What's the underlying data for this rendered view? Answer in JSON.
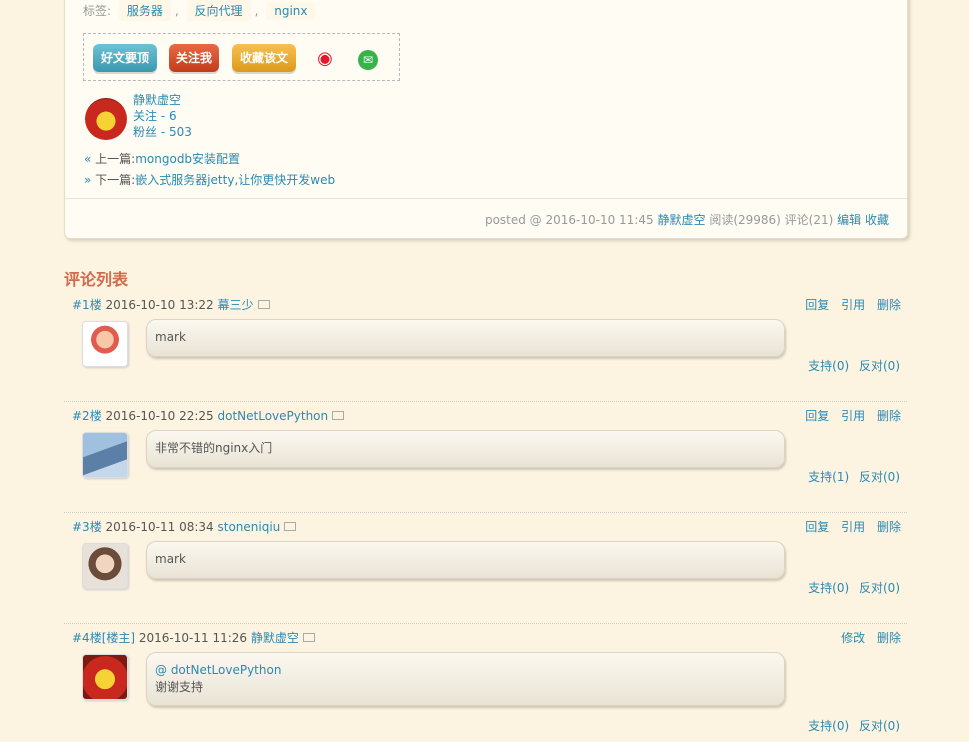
{
  "post": {
    "tags_label": "标签:",
    "tags": [
      "服务器",
      "反向代理",
      "nginx"
    ],
    "tag_sep": ",",
    "buttons": {
      "good": "好文要顶",
      "follow": "关注我",
      "favorite": "收藏该文"
    },
    "share_icons": [
      "weibo-icon",
      "wechat-icon"
    ],
    "author": {
      "name": "静默虚空",
      "following": "关注 - 6",
      "fans": "粉丝 - 503"
    },
    "nav": {
      "prev_arrow": "«",
      "prev_prefix": "上一篇:",
      "prev_title": "mongodb安装配置",
      "next_arrow": "»",
      "next_prefix": "下一篇:",
      "next_title": "嵌入式服务器jetty,让你更快开发web"
    },
    "footer": {
      "posted": "posted @ 2016-10-10 11:45",
      "author": "静默虚空",
      "stats": "阅读(29986) 评论(21)",
      "edit": "编辑",
      "favorite": "收藏"
    }
  },
  "comments_title": "评论列表",
  "comments": [
    {
      "floor": "#1楼",
      "time": "2016-10-10 13:22",
      "user": "幕三少",
      "actions": [
        "回复",
        "引用",
        "删除"
      ],
      "lines": [
        "mark"
      ],
      "support": "支持(0)",
      "oppose": "反对(0)"
    },
    {
      "floor": "#2楼",
      "time": "2016-10-10 22:25",
      "user": "dotNetLovePython",
      "actions": [
        "回复",
        "引用",
        "删除"
      ],
      "lines": [
        "非常不错的nginx入门"
      ],
      "support": "支持(1)",
      "oppose": "反对(0)"
    },
    {
      "floor": "#3楼",
      "time": "2016-10-11 08:34",
      "user": "stoneniqiu",
      "actions": [
        "回复",
        "引用",
        "删除"
      ],
      "lines": [
        "mark"
      ],
      "support": "支持(0)",
      "oppose": "反对(0)"
    },
    {
      "floor": "#4楼[楼主]",
      "time": "2016-10-11 11:26",
      "user": "静默虚空",
      "actions": [
        "修改",
        "删除"
      ],
      "lines": [
        "@ dotNetLovePython",
        "谢谢支持"
      ],
      "support": "支持(0)",
      "oppose": "反对(0)"
    }
  ]
}
